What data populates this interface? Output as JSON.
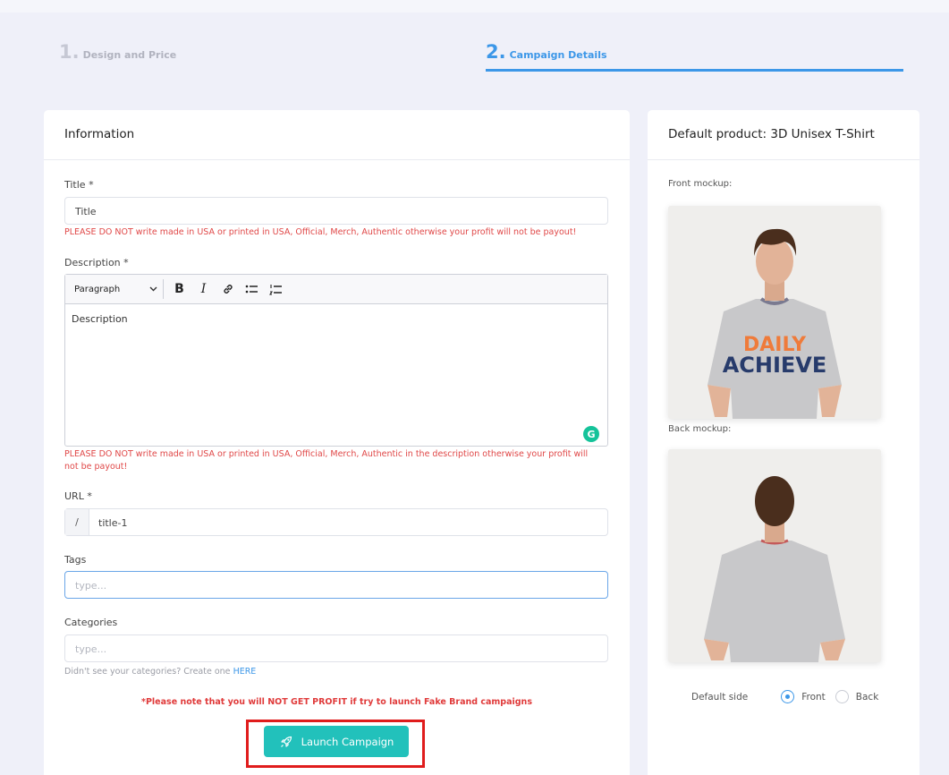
{
  "steps": [
    {
      "num": "1.",
      "label": "Design and Price"
    },
    {
      "num": "2.",
      "label": "Campaign Details"
    }
  ],
  "info": {
    "heading": "Information",
    "title_label": "Title *",
    "title_value": "Title",
    "title_warning": "PLEASE DO NOT write made in USA or printed in USA, Official, Merch, Authentic otherwise your profit will not be payout!",
    "description_label": "Description *",
    "editor_format": "Paragraph",
    "description_value": "Description",
    "description_warning": "PLEASE DO NOT write made in USA or printed in USA, Official, Merch, Authentic in the description otherwise your profit will not be payout!",
    "url_label": "URL *",
    "url_prefix": "/",
    "url_value": "title-1",
    "tags_label": "Tags",
    "tags_placeholder": "type...",
    "categories_label": "Categories",
    "categories_placeholder": "type...",
    "categories_hint": "Didn't see your categories? Create one",
    "categories_hint_link": "HERE",
    "fake_brand_note": "*Please note that you will NOT GET PROFIT if try to launch Fake Brand campaigns",
    "launch_label": "Launch Campaign"
  },
  "product": {
    "heading": "Default product: 3D Unisex T-Shirt",
    "front_label": "Front mockup:",
    "front_print_top": "DAILY",
    "front_print_bottom": "ACHIEVE",
    "back_label": "Back mockup:",
    "default_side_label": "Default side",
    "side_front": "Front",
    "side_back": "Back",
    "selected_side": "Front"
  },
  "colors": {
    "accent": "#3c97e8",
    "launch": "#22c1bb",
    "warning": "#e04848",
    "highlight": "#e01c1c"
  }
}
